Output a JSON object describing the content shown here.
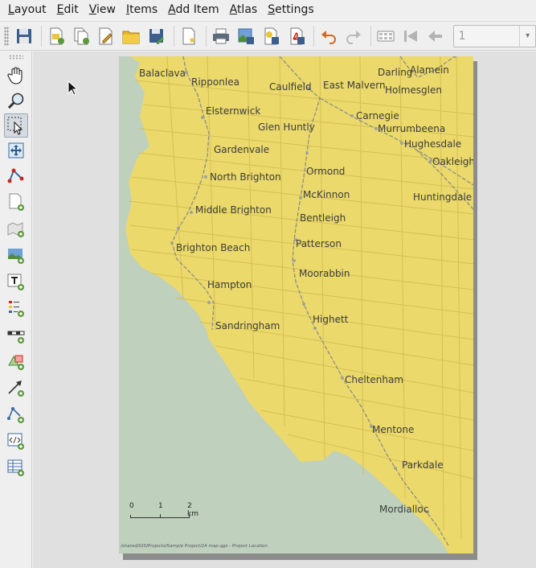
{
  "menubar": {
    "items": [
      "Layout",
      "Edit",
      "View",
      "Items",
      "Add Item",
      "Atlas",
      "Settings"
    ]
  },
  "toolbar": {
    "tools": [
      "save-icon",
      "new-layout-icon",
      "duplicate-layout-icon",
      "layout-manager-icon",
      "open-template-icon",
      "save-as-template-icon",
      "new-report-icon",
      "print-icon",
      "export-image-icon",
      "export-svg-icon",
      "export-pdf-icon",
      "undo-icon",
      "redo-icon",
      "atlas-preview-icon",
      "first-feature-icon",
      "previous-feature-icon"
    ],
    "atlas_page_value": "1"
  },
  "sidebar": {
    "tools": [
      "pan-icon",
      "zoom-icon",
      "select-icon",
      "move-content-icon",
      "edit-nodes-icon",
      "add-page-icon",
      "add-map-icon",
      "add-picture-icon",
      "add-label-icon",
      "add-legend-icon",
      "add-scalebar-icon",
      "add-shape-icon",
      "add-arrow-icon",
      "add-node-item-icon",
      "add-html-icon",
      "add-attribute-table-icon"
    ],
    "active_index": 2
  },
  "map": {
    "places": [
      {
        "name": "Balaclava"
      },
      {
        "name": "Ripponlea"
      },
      {
        "name": "Caulfield"
      },
      {
        "name": "East Malvern"
      },
      {
        "name": "Darling"
      },
      {
        "name": "Alamein"
      },
      {
        "name": "Holmesglen"
      },
      {
        "name": "Elsternwick"
      },
      {
        "name": "Carnegie"
      },
      {
        "name": "Glen Huntly"
      },
      {
        "name": "Murrumbeena"
      },
      {
        "name": "Hughesdale"
      },
      {
        "name": "Gardenvale"
      },
      {
        "name": "Oakleigh"
      },
      {
        "name": "Ormond"
      },
      {
        "name": "North Brighton"
      },
      {
        "name": "McKinnon"
      },
      {
        "name": "Huntingdale"
      },
      {
        "name": "Middle Brighton"
      },
      {
        "name": "Bentleigh"
      },
      {
        "name": "Patterson"
      },
      {
        "name": "Brighton Beach"
      },
      {
        "name": "Moorabbin"
      },
      {
        "name": "Hampton"
      },
      {
        "name": "Highett"
      },
      {
        "name": "Sandringham"
      },
      {
        "name": "Cheltenham"
      },
      {
        "name": "Mentone"
      },
      {
        "name": "Parkdale"
      },
      {
        "name": "Mordialloc"
      }
    ],
    "scalebar": {
      "labels": [
        "0",
        "1",
        "2 km"
      ]
    },
    "footer": "/shared/GIS/Projects/Sample Project/24 map.qgs - Project Location",
    "colors": {
      "land": "#ecd96b",
      "water": "#bfd0bd",
      "roads": "#d4bf55",
      "rail": "#8c8f84"
    }
  }
}
